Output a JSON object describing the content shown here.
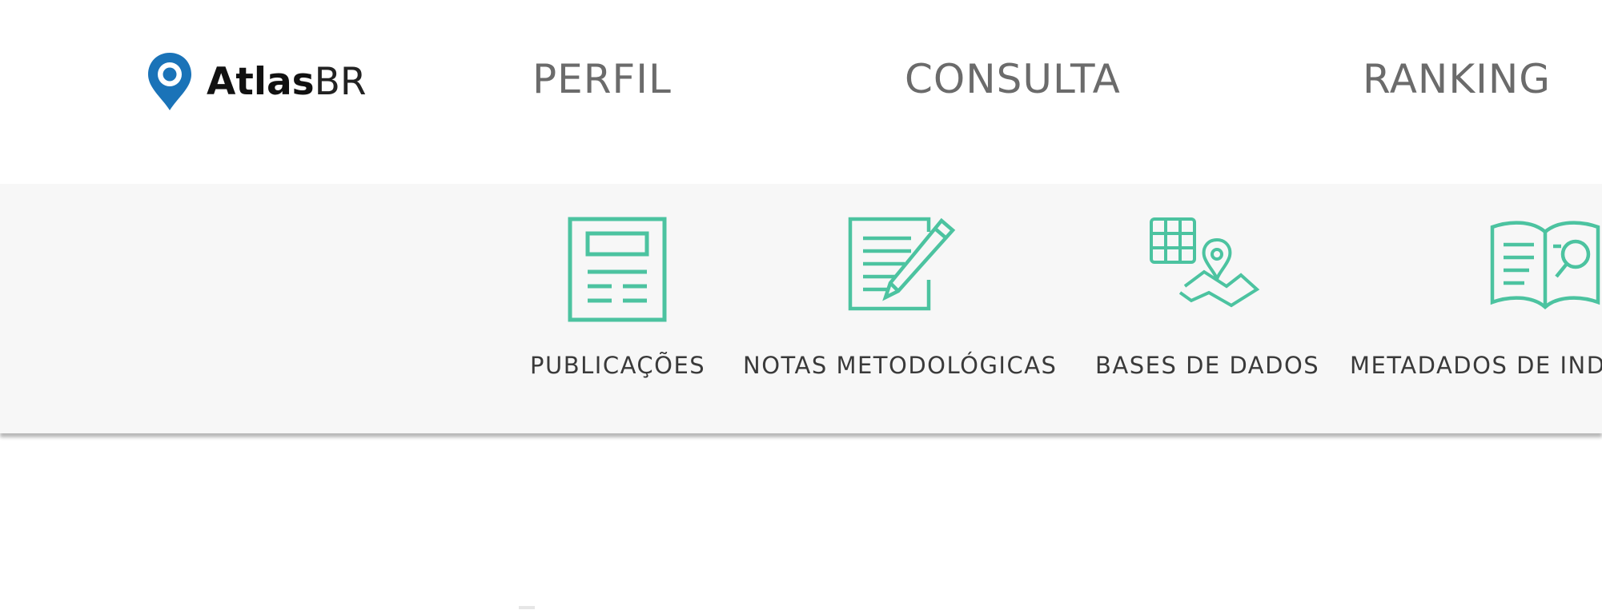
{
  "logo": {
    "text_bold": "Atlas",
    "text_light": "BR",
    "icon": "map-pin-icon",
    "color": "#1a73b8"
  },
  "nav": {
    "items": [
      {
        "label": "PERFIL"
      },
      {
        "label": "CONSULTA"
      },
      {
        "label": "RANKING"
      }
    ]
  },
  "tools": {
    "accent_color": "#4cc3a0",
    "items": [
      {
        "label": "PUBLICAÇÕES",
        "icon": "publication-icon"
      },
      {
        "label": "NOTAS METODOLÓGICAS",
        "icon": "notes-pencil-icon"
      },
      {
        "label": "BASES DE DADOS",
        "icon": "database-map-icon"
      },
      {
        "label": "METADADOS DE IND",
        "icon": "book-search-icon"
      }
    ]
  }
}
